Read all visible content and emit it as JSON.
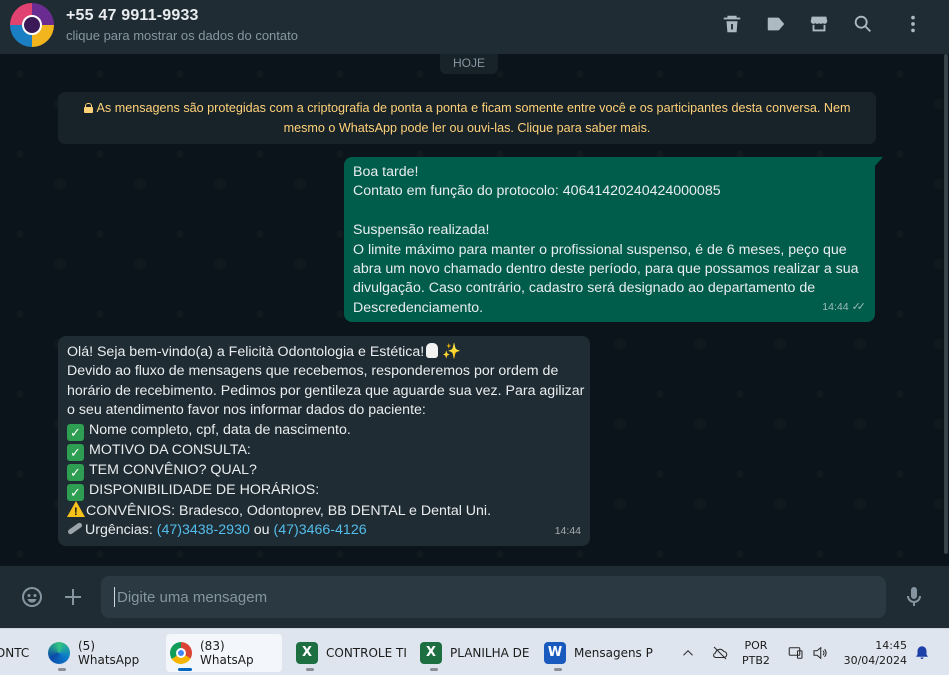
{
  "header": {
    "contact_name": "+55 47 9911-9933",
    "contact_subtitle": "clique para mostrar os dados do contato",
    "icons": [
      "delete-icon",
      "label-icon",
      "catalog-icon",
      "search-icon",
      "menu-icon"
    ]
  },
  "chat": {
    "date_chip": "HOJE",
    "encryption_notice": {
      "line1": "As mensagens são protegidas com a criptografia de ponta a ponta e ficam somente entre você e os participantes desta conversa. Nem",
      "line2": "mesmo o WhatsApp pode ler ou ouvi-las. Clique para saber mais."
    },
    "outgoing": {
      "lines": [
        "Boa tarde!",
        "Contato em função do protocolo: 40641420240424000085",
        "",
        "Suspensão realizada!",
        "O limite máximo para manter o profissional suspenso, é de 6 meses, peço que",
        "abra um novo chamado dentro deste período, para que possamos realizar a sua",
        "divulgação. Caso contrário, cadastro será designado ao departamento de",
        "Descredenciamento."
      ],
      "time": "14:44",
      "status": "read"
    },
    "incoming": {
      "greeting": "Olá! Seja bem-vindo(a) a Felicità Odontologia e Estética!",
      "lines": [
        "Devido ao fluxo de mensagens que recebemos, responderemos  por ordem de",
        "horário de recebimento. Pedimos por gentileza que aguarde sua vez.  Para agilizar",
        "o seu atendimento favor nos informar dados do paciente:"
      ],
      "checklist": [
        "Nome completo, cpf, data de nascimento.",
        "MOTIVO DA CONSULTA:",
        "TEM CONVÊNIO? QUAL?",
        "DISPONIBILIDADE DE HORÁRIOS:"
      ],
      "convenios": "CONVÊNIOS: Bradesco, Odontoprev, BB DENTAL e Dental Uni.",
      "urgencias_label": "Urgências: ",
      "phone1": "(47)3438-2930",
      "or": " ou ",
      "phone2": "(47)3466-4126",
      "time": "14:44"
    }
  },
  "composer": {
    "placeholder": "Digite uma mensagem",
    "value": ""
  },
  "taskbar": {
    "items": [
      {
        "label": "DNTC",
        "icon": "app-icon"
      },
      {
        "label": "(5) WhatsApp",
        "icon": "edge-icon"
      },
      {
        "label": "(83) WhatsAp",
        "icon": "chrome-icon"
      },
      {
        "label": "CONTROLE TI",
        "icon": "excel-icon"
      },
      {
        "label": "PLANILHA DE",
        "icon": "excel-icon"
      },
      {
        "label": "Mensagens P",
        "icon": "word-icon"
      }
    ],
    "lang_line1": "POR",
    "lang_line2": "PTB2",
    "time": "14:45",
    "date": "30/04/2024"
  },
  "colors": {
    "outgoing_bubble": "#005c4b",
    "incoming_bubble": "#202c33",
    "background": "#0b141a",
    "link": "#53bdeb",
    "notice_text": "#ffd279"
  }
}
